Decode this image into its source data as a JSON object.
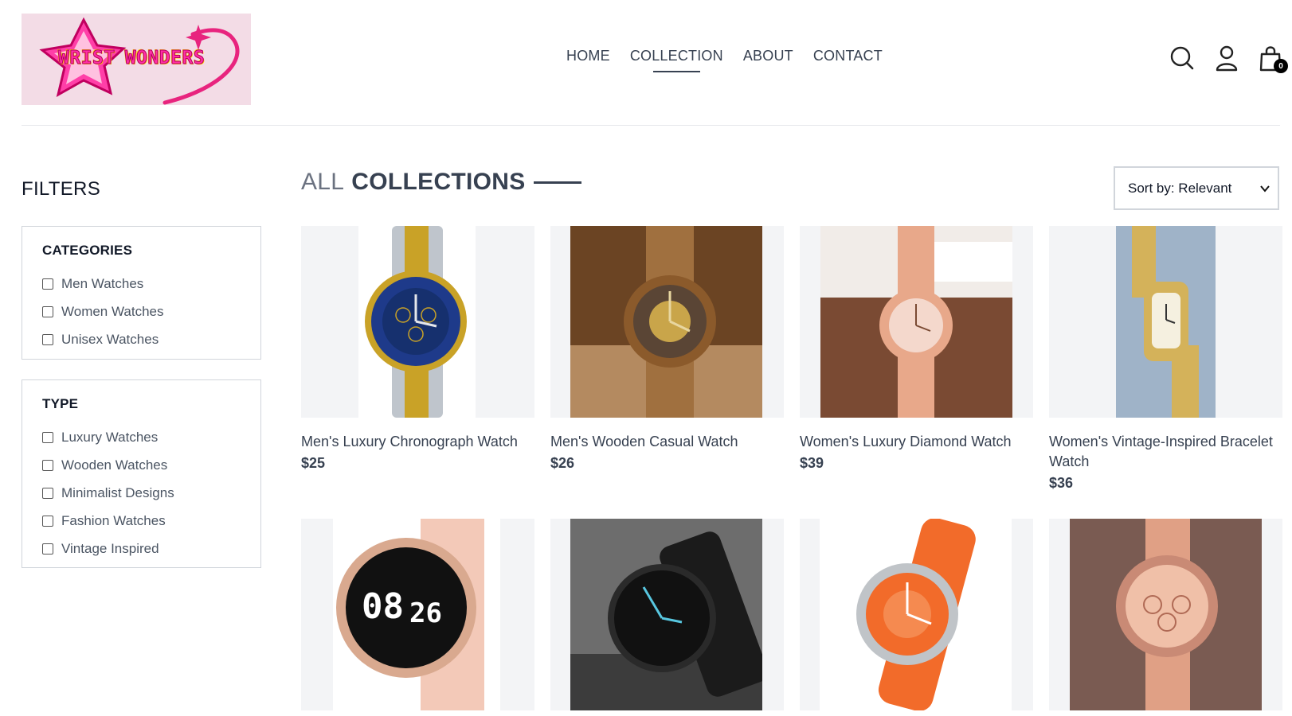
{
  "brand": {
    "logo_text_1": "WRIST",
    "logo_text_2": "WONDERS"
  },
  "nav": {
    "items": [
      {
        "label": "HOME",
        "active": false
      },
      {
        "label": "COLLECTION",
        "active": true
      },
      {
        "label": "ABOUT",
        "active": false
      },
      {
        "label": "CONTACT",
        "active": false
      }
    ]
  },
  "header_icons": {
    "search": "search-icon",
    "profile": "user-icon",
    "cart": "shopping-bag-icon",
    "cart_count": "0"
  },
  "filters": {
    "title": "FILTERS",
    "categories": {
      "heading": "CATEGORIES",
      "options": [
        "Men Watches",
        "Women Watches",
        "Unisex Watches"
      ]
    },
    "type": {
      "heading": "TYPE",
      "options": [
        "Luxury Watches",
        "Wooden Watches",
        "Minimalist Designs",
        "Fashion Watches",
        "Vintage Inspired"
      ]
    }
  },
  "main": {
    "title_light": "ALL",
    "title_bold": "COLLECTIONS",
    "sort": {
      "selected": "Sort by: Relevant"
    }
  },
  "products": [
    {
      "name": "Men's Luxury Chronograph Watch",
      "price": "$25",
      "colors": [
        "#1e3a8a",
        "#c9a227",
        "#bfc5cc"
      ]
    },
    {
      "name": "Men's Wooden Casual Watch",
      "price": "$26",
      "colors": [
        "#8b5a2b",
        "#b07a45",
        "#6b4423"
      ]
    },
    {
      "name": "Women's Luxury Diamond Watch",
      "price": "$39",
      "colors": [
        "#e8a88a",
        "#7a4a33",
        "#f4d8cc"
      ]
    },
    {
      "name": "Women's Vintage-Inspired Bracelet Watch",
      "price": "$36",
      "colors": [
        "#d4b25a",
        "#9fb3c8",
        "#f5f0e0"
      ]
    },
    {
      "name": "",
      "price": "",
      "colors": [
        "#f3c9b8",
        "#111111",
        "#d9a98f"
      ]
    },
    {
      "name": "",
      "price": "",
      "colors": [
        "#1b1b1b",
        "#58c7e0",
        "#6d6d6d"
      ]
    },
    {
      "name": "",
      "price": "",
      "colors": [
        "#f26b2a",
        "#c0c4c8",
        "#ffffff"
      ]
    },
    {
      "name": "",
      "price": "",
      "colors": [
        "#e0a085",
        "#7a5b52",
        "#c98a75"
      ]
    }
  ]
}
